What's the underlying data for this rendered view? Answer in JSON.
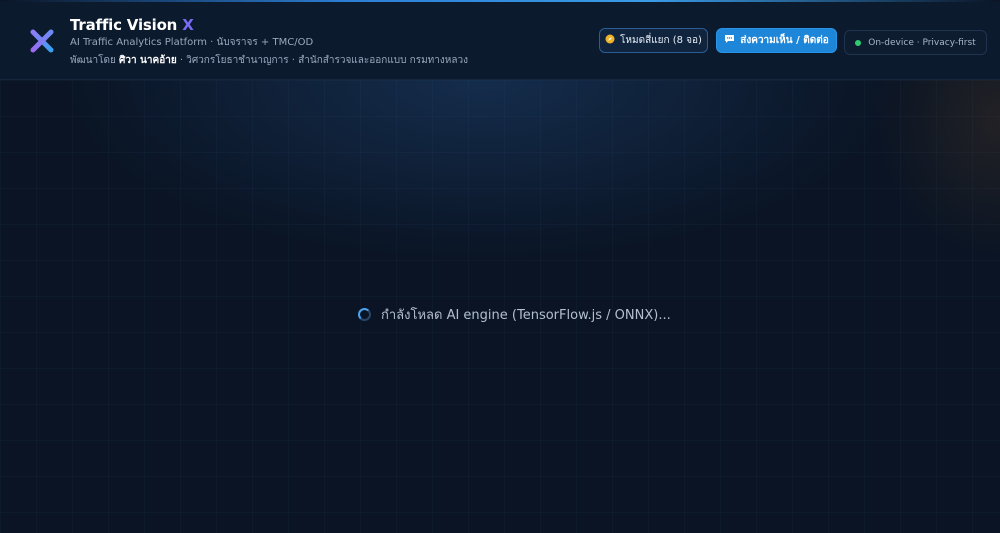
{
  "header": {
    "brand_name": "Traffic Vision",
    "brand_mark": "X",
    "subtitle": "AI Traffic Analytics Platform · นับจราจร + TMC/OD",
    "credit_prefix": "พัฒนาโดย",
    "credit_name": "ศิวา นาคอ้าย",
    "credit_suffix": "· วิศวกรโยธาชำนาญการ · สำนักสำรวจและออกแบบ กรมทางหลวง",
    "split_mode_label": "โหมดสี่แยก (8 จอ)",
    "split_mode_icon": "compass-icon",
    "feedback_label": "ส่งความเห็น / ติดต่อ",
    "feedback_icon": "chat-bubble-icon",
    "status_label": "On-device · Privacy-first",
    "status_color": "#2ecc71"
  },
  "main": {
    "loading_text": "กำลังโหลด AI engine (TensorFlow.js / ONNX)..."
  },
  "colors": {
    "accent": "#1e86d8",
    "brand_mark": "#7b6cf6",
    "background": "#0a1424"
  }
}
